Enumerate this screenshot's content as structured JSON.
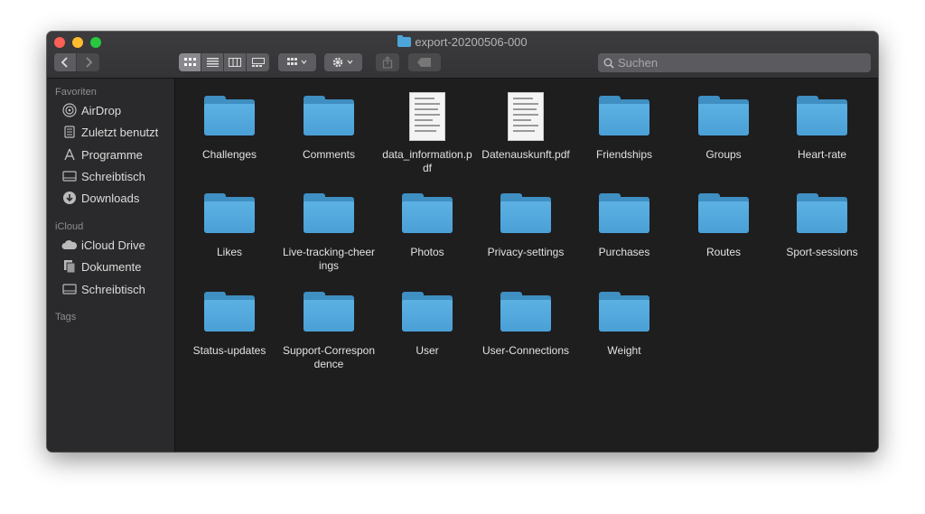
{
  "window": {
    "title": "export-20200506-000"
  },
  "search": {
    "placeholder": "Suchen"
  },
  "sidebar": {
    "sections": [
      {
        "header": "Favoriten",
        "items": [
          {
            "label": "AirDrop",
            "icon": "airdrop-icon"
          },
          {
            "label": "Zuletzt benutzt",
            "icon": "recents-icon"
          },
          {
            "label": "Programme",
            "icon": "applications-icon"
          },
          {
            "label": "Schreibtisch",
            "icon": "desktop-icon"
          },
          {
            "label": "Downloads",
            "icon": "downloads-icon"
          }
        ]
      },
      {
        "header": "iCloud",
        "items": [
          {
            "label": "iCloud Drive",
            "icon": "cloud-icon"
          },
          {
            "label": "Dokumente",
            "icon": "documents-icon"
          },
          {
            "label": "Schreibtisch",
            "icon": "desktop-icon"
          }
        ]
      },
      {
        "header": "Tags",
        "items": []
      }
    ]
  },
  "items": [
    {
      "name": "Challenges",
      "type": "folder"
    },
    {
      "name": "Comments",
      "type": "folder"
    },
    {
      "name": "data_information.pdf",
      "type": "pdf"
    },
    {
      "name": "Datenauskunft.pdf",
      "type": "pdf"
    },
    {
      "name": "Friendships",
      "type": "folder"
    },
    {
      "name": "Groups",
      "type": "folder"
    },
    {
      "name": "Heart-rate",
      "type": "folder"
    },
    {
      "name": "Likes",
      "type": "folder"
    },
    {
      "name": "Live-tracking-cheerings",
      "type": "folder"
    },
    {
      "name": "Photos",
      "type": "folder"
    },
    {
      "name": "Privacy-settings",
      "type": "folder"
    },
    {
      "name": "Purchases",
      "type": "folder"
    },
    {
      "name": "Routes",
      "type": "folder"
    },
    {
      "name": "Sport-sessions",
      "type": "folder"
    },
    {
      "name": "Status-updates",
      "type": "folder"
    },
    {
      "name": "Support-Correspondence",
      "type": "folder"
    },
    {
      "name": "User",
      "type": "folder"
    },
    {
      "name": "User-Connections",
      "type": "folder"
    },
    {
      "name": "Weight",
      "type": "folder"
    }
  ],
  "colors": {
    "folder": "#4aa0d6",
    "window_bg": "#1e1e1f",
    "sidebar_bg": "#2a2a2c"
  }
}
